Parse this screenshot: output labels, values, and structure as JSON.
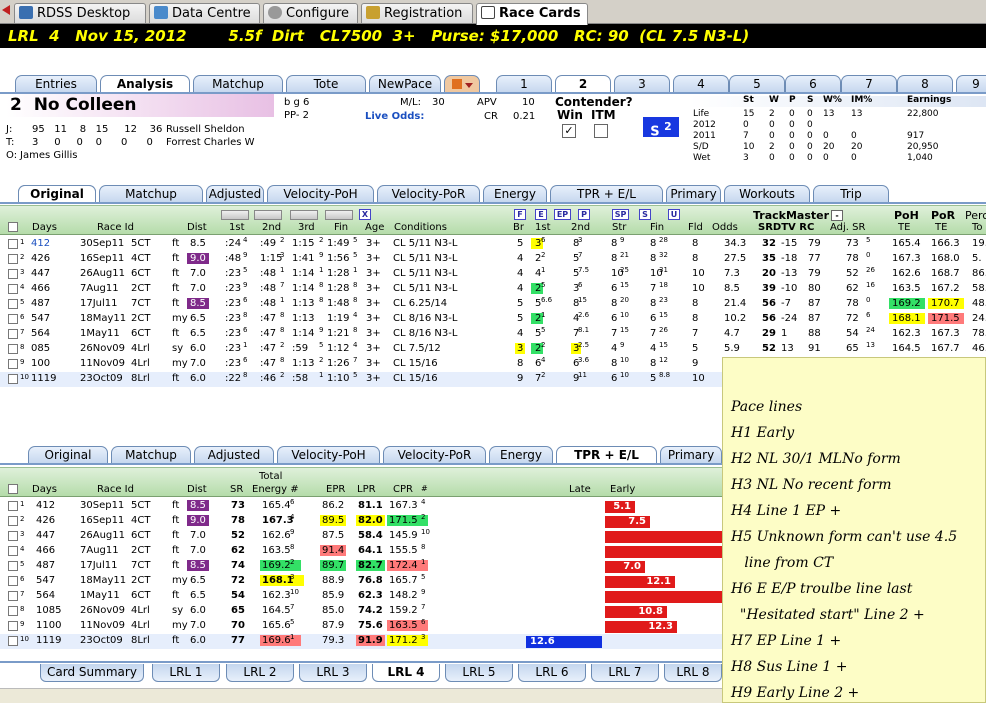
{
  "top_tabs": [
    "RDSS Desktop",
    "Data Centre",
    "Configure",
    "Registration",
    "Race Cards"
  ],
  "race_header": "LRL  4   Nov 15, 2012        5.5f  Dirt   CL7500  3+   Purse: $17,000   RC: 90  (CL 7.5 N3-L)",
  "horse_tabs": [
    "Entries",
    "Analysis",
    "Matchup",
    "Tote",
    "NewPace"
  ],
  "number_tabs": [
    "1",
    "2",
    "3",
    "4",
    "5",
    "6",
    "7",
    "8",
    "9"
  ],
  "horse": {
    "num": "2",
    "name": "No Colleen",
    "bg": "b g 6",
    "pp": "PP- 2",
    "ml_label": "M/L:",
    "ml": "30",
    "live_odds": "Live Odds:",
    "apv_label": "APV",
    "apv": "10",
    "cr_label": "CR",
    "cr": "0.21",
    "j_label": "J:",
    "j_stats": "95   11    8   15     12    36",
    "jockey": "Russell Sheldon",
    "t_label": "T:",
    "t_stats": "3     0     0    0      0      0",
    "trainer": "Forrest Charles W",
    "o_label": "O:",
    "owner": "James Gillis"
  },
  "contender": {
    "title": "Contender?",
    "win": "Win",
    "itm": "ITM",
    "s_badge": "S"
  },
  "stats": {
    "headers": [
      "St",
      "W",
      "P",
      "S",
      "W%",
      "IM%",
      "Earnings"
    ],
    "rows": [
      [
        "Life",
        "15",
        "2",
        "0",
        "0",
        "13",
        "13",
        "22,800"
      ],
      [
        "2012",
        "0",
        "0",
        "0",
        "0",
        "",
        "",
        ""
      ],
      [
        "2011",
        "7",
        "0",
        "0",
        "0",
        "0",
        "0",
        "917"
      ],
      [
        "S/D",
        "10",
        "2",
        "0",
        "0",
        "20",
        "20",
        "20,950"
      ],
      [
        "Wet",
        "3",
        "0",
        "0",
        "0",
        "0",
        "0",
        "1,040"
      ]
    ]
  },
  "analysis_tabs": [
    "Original",
    "Matchup",
    "Adjusted",
    "Velocity-PoH",
    "Velocity-PoR",
    "Energy",
    "TPR + E/L",
    "Primary",
    "Workouts",
    "Trip"
  ],
  "upper": {
    "headers": {
      "days": "Days",
      "raceid": "Race Id",
      "dist": "Dist",
      "c1": "1st",
      "c2": "2nd",
      "c3": "3rd",
      "fin": "Fin",
      "age": "Age",
      "cond": "Conditions",
      "br": "Br",
      "st1": "1st",
      "st2": "2nd",
      "str": "Str",
      "sfin": "Fin",
      "fld": "Fld",
      "odds": "Odds",
      "tm": "TrackMaster",
      "tmsub": "SRDTV  RC",
      "adj": "Adj. SR",
      "poh": "PoH",
      "pohte": "TE",
      "por": "PoR",
      "porte": "TE",
      "perc": "Perc",
      "percto": "To"
    },
    "pace_letters": [
      "F",
      "E",
      "EP",
      "P",
      "SP",
      "S",
      "U"
    ],
    "rows": [
      [
        "1",
        "412",
        "30Sep11",
        "5CT",
        "ft",
        "8.5",
        ":24",
        "4",
        ":49",
        "2",
        "1:15",
        "2",
        "1:49",
        "5",
        "3+",
        "CL 5/11 N3-L",
        "5",
        "3",
        "6",
        "8",
        "3",
        "8",
        "9",
        "8",
        "28",
        "8",
        "34.3",
        "32",
        "-15",
        "79",
        "73",
        "5",
        "165.4",
        "166.3",
        "19."
      ],
      [
        "2",
        "426",
        "16Sep11",
        "4CT",
        "ft",
        "9.0",
        ":48",
        "9",
        "1:15",
        "3",
        "1:41",
        "9",
        "1:56",
        "5",
        "3+",
        "CL 5/11 N3-L",
        "4",
        "2",
        "2",
        "5",
        "7",
        "8",
        "21",
        "8",
        "32",
        "8",
        "27.5",
        "35",
        "-18",
        "77",
        "78",
        "0",
        "167.3",
        "168.0",
        "5."
      ],
      [
        "3",
        "447",
        "26Aug11",
        "6CT",
        "ft",
        "7.0",
        ":23",
        "5",
        ":48",
        "1",
        "1:14",
        "1",
        "1:28",
        "1",
        "3+",
        "CL 5/11 N3-L",
        "4",
        "4",
        "1",
        "5",
        "7.5",
        "10",
        "25",
        "10",
        "31",
        "10",
        "7.3",
        "20",
        "-13",
        "79",
        "52",
        "26",
        "162.6",
        "168.7",
        "86."
      ],
      [
        "4",
        "466",
        "7Aug11",
        "2CT",
        "ft",
        "7.0",
        ":23",
        "9",
        ":48",
        "7",
        "1:14",
        "8",
        "1:28",
        "8",
        "3+",
        "CL 5/11 N3-L",
        "4",
        "2",
        "5",
        "3",
        "6",
        "6",
        "15",
        "7",
        "18",
        "10",
        "8.5",
        "39",
        "-10",
        "80",
        "62",
        "16",
        "163.5",
        "167.2",
        "58."
      ],
      [
        "5",
        "487",
        "17Jul11",
        "7CT",
        "ft",
        "8.5",
        ":23",
        "6",
        ":48",
        "1",
        "1:13",
        "8",
        "1:48",
        "8",
        "3+",
        "CL 6.25/14",
        "5",
        "5",
        "6.6",
        "8",
        "15",
        "8",
        "20",
        "8",
        "23",
        "8",
        "21.4",
        "56",
        "-7",
        "87",
        "78",
        "0",
        "169.2",
        "170.7",
        "48."
      ],
      [
        "6",
        "547",
        "18May11",
        "2CT",
        "my",
        "6.5",
        ":23",
        "8",
        ":47",
        "8",
        "1:13",
        "",
        "1:19",
        "4",
        "3+",
        "CL 8/16 N3-L",
        "5",
        "2",
        "1",
        "4",
        "2.6",
        "6",
        "10",
        "6",
        "15",
        "8",
        "10.2",
        "56",
        "-24",
        "87",
        "72",
        "6",
        "168.1",
        "171.5",
        "24."
      ],
      [
        "7",
        "564",
        "1May11",
        "6CT",
        "ft",
        "6.5",
        ":23",
        "6",
        ":47",
        "8",
        "1:14",
        "9",
        "1:21",
        "8",
        "3+",
        "CL 8/16 N3-L",
        "4",
        "5",
        "5",
        "7",
        "8.1",
        "7",
        "15",
        "7",
        "26",
        "7",
        "4.7",
        "29",
        "1",
        "88",
        "54",
        "24",
        "162.3",
        "167.3",
        "78."
      ],
      [
        "8",
        "085",
        "26Nov09",
        "4Lrl",
        "sy",
        "6.0",
        ":23",
        "1",
        ":47",
        "2",
        ":59",
        "5",
        "1:12",
        "4",
        "3+",
        "CL 7.5/12",
        "3",
        "2",
        "2",
        "3",
        "2.5",
        "4",
        "9",
        "4",
        "15",
        "5",
        "5.9",
        "52",
        "13",
        "91",
        "65",
        "13",
        "164.5",
        "167.7",
        "46."
      ],
      [
        "9",
        "100",
        "11Nov09",
        "4Lrl",
        "my",
        "7.0",
        ":23",
        "6",
        ":47",
        "8",
        "1:13",
        "2",
        "1:26",
        "7",
        "3+",
        "CL 15/16",
        "8",
        "6",
        "4",
        "6",
        "3.6",
        "8",
        "10",
        "8",
        "12",
        "9",
        "",
        "",
        "",
        "",
        "",
        "",
        "",
        "",
        ""
      ],
      [
        "10",
        "1119",
        "23Oct09",
        "8Lrl",
        "ft",
        "6.0",
        ":22",
        "8",
        ":46",
        "2",
        ":58",
        "1",
        "1:10",
        "5",
        "3+",
        "CL 15/16",
        "9",
        "7",
        "2",
        "9",
        "11",
        "6",
        "10",
        "5",
        "8.8",
        "10",
        "",
        "",
        "",
        "",
        "",
        "",
        "",
        "",
        ""
      ]
    ]
  },
  "lower": {
    "headers": {
      "days": "Days",
      "raceid": "Race Id",
      "dist": "Dist",
      "sr": "SR",
      "total": "Total",
      "energy": "Energy #",
      "epr": "EPR",
      "lpr": "LPR",
      "cpr": "CPR",
      "hash": "#",
      "late": "Late",
      "early": "Early"
    },
    "rows": [
      [
        "1",
        "412",
        "30Sep11",
        "5CT",
        "ft",
        "8.5",
        "73",
        "165.4",
        "6",
        "86.2",
        "81.1",
        "167.3",
        "4",
        "5.1"
      ],
      [
        "2",
        "426",
        "16Sep11",
        "4CT",
        "ft",
        "9.0",
        "78",
        "167.3",
        "4",
        "89.5",
        "82.0",
        "171.5",
        "2",
        "7.5"
      ],
      [
        "3",
        "447",
        "26Aug11",
        "6CT",
        "ft",
        "7.0",
        "52",
        "162.6",
        "9",
        "87.5",
        "58.4",
        "145.9",
        "10",
        ""
      ],
      [
        "4",
        "466",
        "7Aug11",
        "2CT",
        "ft",
        "7.0",
        "62",
        "163.5",
        "8",
        "91.4",
        "64.1",
        "155.5",
        "8",
        ""
      ],
      [
        "5",
        "487",
        "17Jul11",
        "7CT",
        "ft",
        "8.5",
        "74",
        "169.2",
        "2",
        "89.7",
        "82.7",
        "172.4",
        "1",
        "7.0"
      ],
      [
        "6",
        "547",
        "18May11",
        "2CT",
        "my",
        "6.5",
        "72",
        "168.1",
        "3",
        "88.9",
        "76.8",
        "165.7",
        "5",
        "12.1"
      ],
      [
        "7",
        "564",
        "1May11",
        "6CT",
        "ft",
        "6.5",
        "54",
        "162.3",
        "10",
        "85.9",
        "62.3",
        "148.2",
        "9",
        ""
      ],
      [
        "8",
        "1085",
        "26Nov09",
        "4Lrl",
        "sy",
        "6.0",
        "65",
        "164.5",
        "7",
        "85.0",
        "74.2",
        "159.2",
        "7",
        "10.8"
      ],
      [
        "9",
        "1100",
        "11Nov09",
        "4Lrl",
        "my",
        "7.0",
        "70",
        "165.6",
        "5",
        "87.9",
        "75.6",
        "163.5",
        "6",
        "12.3"
      ],
      [
        "10",
        "1119",
        "23Oct09",
        "8Lrl",
        "ft",
        "6.0",
        "77",
        "169.6",
        "1",
        "79.3",
        "91.9",
        "171.2",
        "3",
        ""
      ]
    ],
    "late_val": "12.6"
  },
  "bottom_tabs": [
    "Card Summary",
    "LRL 1",
    "LRL 2",
    "LRL 3",
    "LRL 4",
    "LRL 5",
    "LRL 6",
    "LRL 7",
    "LRL 8"
  ],
  "note": [
    "Pace lines",
    "H1 Early",
    "H2 NL 30/1 MLNo form",
    "H3 NL No recent form",
    "H4 Line 1 EP +",
    "H5 Unknown form can't use 4.5",
    "   line from CT",
    "H6 E E/P  troulbe line last",
    "  \"Hesitated start\" Line 2 +",
    "H7 EP Line 1 +",
    "H8 Sus Line 1 +",
    "H9 Early Line 2 +"
  ]
}
